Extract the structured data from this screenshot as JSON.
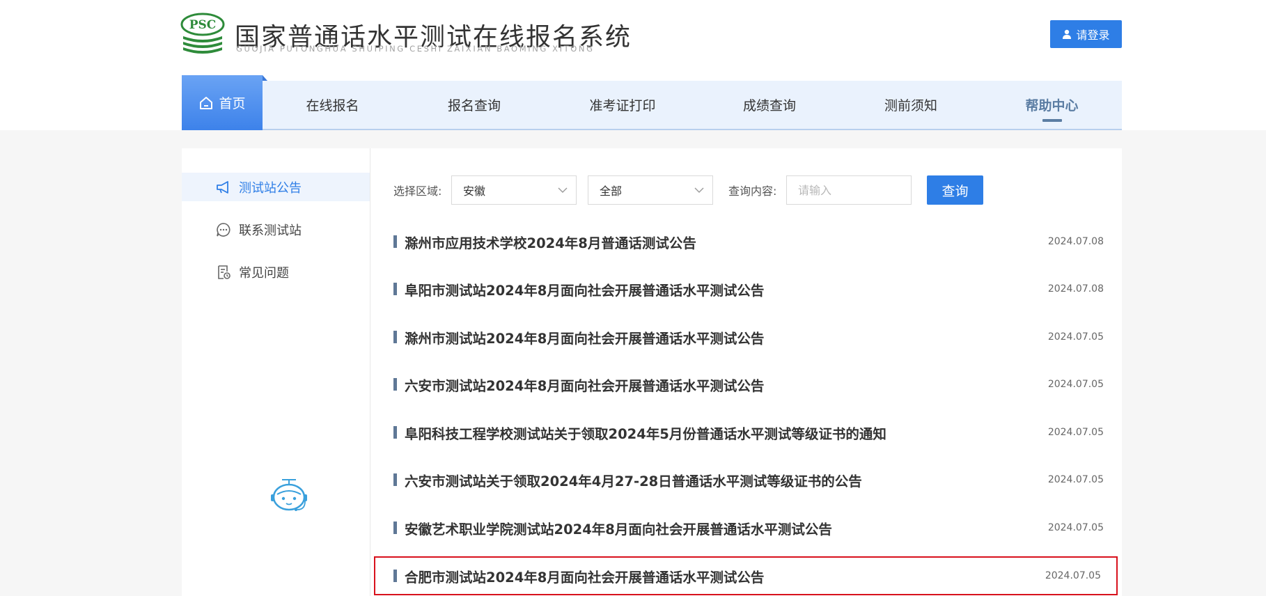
{
  "logo": {
    "mark_text": "PSC",
    "title": "国家普通话水平测试在线报名系统",
    "subtitle": "GUOJIA PUTONGHUA SHUIPING CESHI ZAIXIAN BAOMING XITONG"
  },
  "header": {
    "login_label": "请登录"
  },
  "nav": {
    "items": [
      {
        "label": "首页"
      },
      {
        "label": "在线报名"
      },
      {
        "label": "报名查询"
      },
      {
        "label": "准考证打印"
      },
      {
        "label": "成绩查询"
      },
      {
        "label": "测前须知"
      },
      {
        "label": "帮助中心"
      }
    ],
    "active_index": 6
  },
  "sidebar": {
    "items": [
      {
        "label": "测试站公告",
        "icon": "megaphone-icon"
      },
      {
        "label": "联系测试站",
        "icon": "chat-bubble-icon"
      },
      {
        "label": "常见问题",
        "icon": "document-clock-icon"
      }
    ]
  },
  "filters": {
    "region_label": "选择区域:",
    "province_value": "安徽",
    "city_value": "全部",
    "query_label": "查询内容:",
    "query_placeholder": "请输入",
    "query_value": "",
    "search_button": "查询"
  },
  "notices": [
    {
      "title": "滁州市应用技术学校2024年8月普通话测试公告",
      "date": "2024.07.08"
    },
    {
      "title": "阜阳市测试站2024年8月面向社会开展普通话水平测试公告",
      "date": "2024.07.08"
    },
    {
      "title": "滁州市测试站2024年8月面向社会开展普通话水平测试公告",
      "date": "2024.07.05"
    },
    {
      "title": "六安市测试站2024年8月面向社会开展普通话水平测试公告",
      "date": "2024.07.05"
    },
    {
      "title": "阜阳科技工程学校测试站关于领取2024年5月份普通话水平测试等级证书的通知",
      "date": "2024.07.05"
    },
    {
      "title": "六安市测试站关于领取2024年4月27-28日普通话水平测试等级证书的公告",
      "date": "2024.07.05"
    },
    {
      "title": "安徽艺术职业学院测试站2024年8月面向社会开展普通话水平测试公告",
      "date": "2024.07.05"
    },
    {
      "title": "合肥市测试站2024年8月面向社会开展普通话水平测试公告",
      "date": "2024.07.05"
    }
  ],
  "colors": {
    "accent": "#2e7ee6",
    "nav_bg": "#eaf2fd",
    "highlight_border": "#d8111c",
    "logo_green": "#2e8b3a"
  }
}
